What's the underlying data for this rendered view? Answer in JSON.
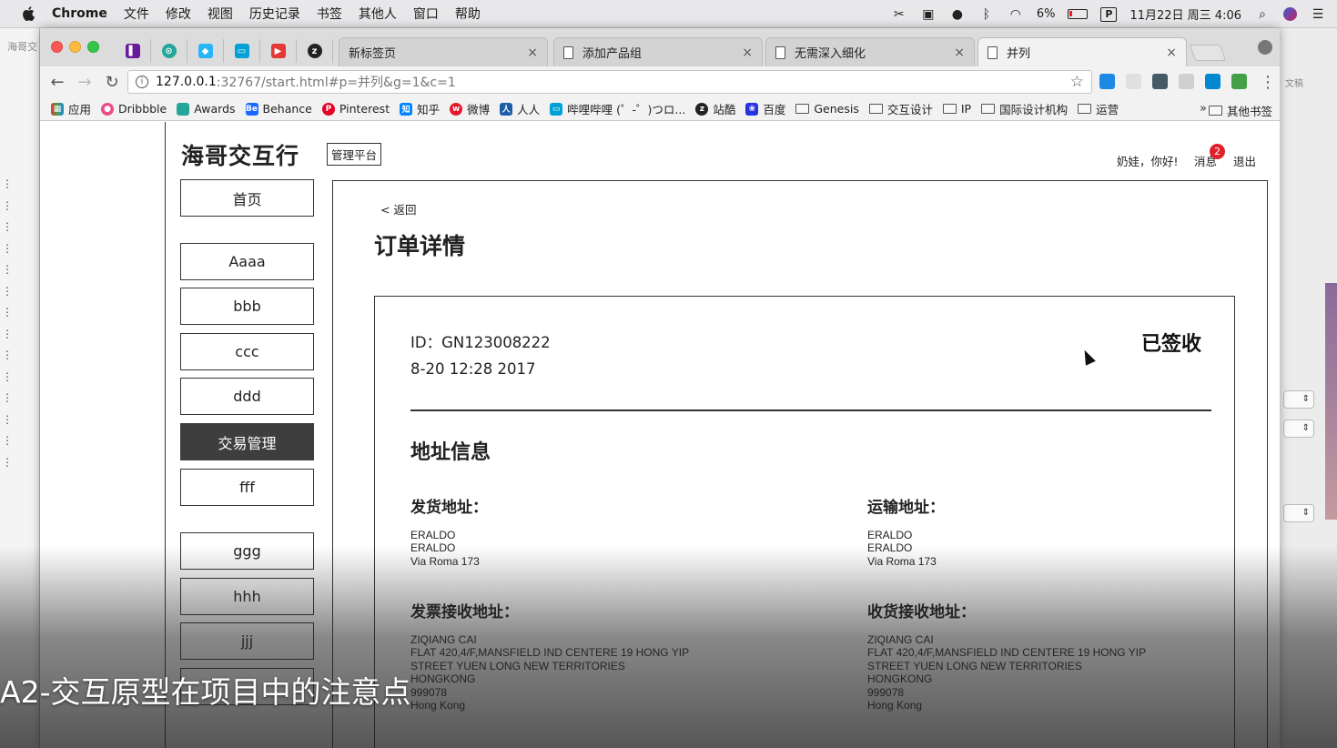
{
  "menubar": {
    "app": "Chrome",
    "items": [
      "文件",
      "修改",
      "视图",
      "历史记录",
      "书签",
      "其他人",
      "窗口",
      "帮助"
    ],
    "battery": "6%",
    "datetime": "11月22日 周三 4:06"
  },
  "desktop": {
    "left_title": "海哥交",
    "right_text": "文稿"
  },
  "tabs": [
    {
      "label": "新标签页"
    },
    {
      "label": "添加产品组"
    },
    {
      "label": "无需深入细化"
    },
    {
      "label": "并列"
    }
  ],
  "address": {
    "host": "127.0.0.1",
    "path": ":32767/start.html#p=并列&g=1&c=1"
  },
  "bookmarks": [
    {
      "label": "应用",
      "color": "#e53935"
    },
    {
      "label": "Dribbble",
      "color": "#ea4c89"
    },
    {
      "label": "Awards",
      "color": "#26a69a"
    },
    {
      "label": "Behance",
      "color": "#1769ff"
    },
    {
      "label": "Pinterest",
      "color": "#e60023"
    },
    {
      "label": "知乎",
      "color": "#0084ff"
    },
    {
      "label": "微博",
      "color": "#e6162d"
    },
    {
      "label": "人人",
      "color": "#1c5da8"
    },
    {
      "label": "哔哩哔哩 (゜-゜)つロ...",
      "color": "#00a1d6"
    },
    {
      "label": "站酷",
      "color": "#222222"
    },
    {
      "label": "百度",
      "color": "#2932e1"
    },
    {
      "label": "Genesis",
      "color": ""
    },
    {
      "label": "交互设计",
      "color": ""
    },
    {
      "label": "IP",
      "color": ""
    },
    {
      "label": "国际设计机构",
      "color": ""
    },
    {
      "label": "运营",
      "color": ""
    }
  ],
  "bookmarks_more": "»",
  "bookmarks_other": "其他书签",
  "site": {
    "brand": "海哥交互行",
    "admin_badge": "管理平台",
    "greeting": "奶娃，你好!",
    "messages": "消息",
    "message_count": "2",
    "logout": "退出"
  },
  "sidebar": [
    "首页",
    "Aaaa",
    "bbb",
    "ccc",
    "ddd",
    "交易管理",
    "fff",
    "ggg",
    "hhh",
    "jjj"
  ],
  "sidebar_active": "交易管理",
  "order": {
    "back": "< 返回",
    "title": "订单详情",
    "id": "ID：GN123008222",
    "date": "8-20 12:28 2017",
    "status": "已签收",
    "section_title": "地址信息",
    "ship_from_title": "发货地址：",
    "ship_from": [
      "ERALDO",
      "ERALDO",
      "Via Roma 173"
    ],
    "transport_title": "运输地址：",
    "transport": [
      "ERALDO",
      "ERALDO",
      "Via Roma 173"
    ],
    "invoice_title": "发票接收地址：",
    "invoice": [
      "ZIQIANG CAI",
      "FLAT 420,4/F,MANSFIELD IND CENTERE 19 HONG YIP",
      "STREET YUEN LONG NEW TERRITORIES",
      "HONGKONG",
      "999078",
      "Hong Kong"
    ],
    "receive_title": "收货接收地址：",
    "receive": [
      "ZIQIANG CAI",
      "FLAT 420,4/F,MANSFIELD IND CENTERE 19 HONG YIP",
      "STREET YUEN LONG NEW TERRITORIES",
      "HONGKONG",
      "999078",
      "Hong Kong"
    ]
  },
  "caption": "A2-交互原型在项目中的注意点"
}
